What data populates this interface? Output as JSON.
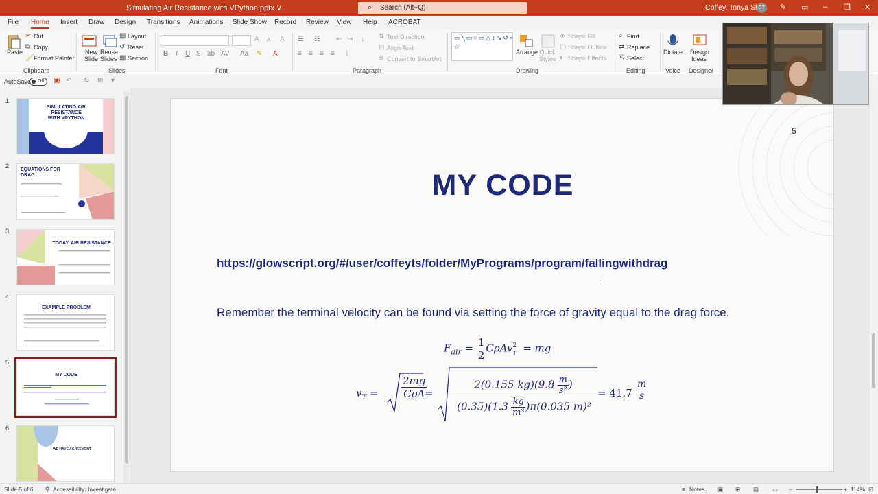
{
  "window": {
    "doc_title": "Simulating Air Resistance with VPython.pptx ∨",
    "search_placeholder": "Search (Alt+Q)",
    "user_name": "Coffey, Tonya Shea",
    "user_initials": "CT"
  },
  "tabs": [
    "File",
    "Home",
    "Insert",
    "Draw",
    "Design",
    "Transitions",
    "Animations",
    "Slide Show",
    "Record",
    "Review",
    "View",
    "Help",
    "ACROBAT"
  ],
  "ribbon": {
    "clipboard": {
      "paste": "Paste",
      "cut": "Cut",
      "copy": "Copy",
      "format_painter": "Format Painter",
      "label": "Clipboard"
    },
    "slides": {
      "new_slide": "New Slide",
      "reuse_slides": "Reuse Slides",
      "layout": "Layout",
      "reset": "Reset",
      "section": "Section",
      "label": "Slides"
    },
    "font": {
      "label": "Font"
    },
    "paragraph": {
      "text_direction": "Text Direction",
      "align_text": "Align Text",
      "convert_smartart": "Convert to SmartArt",
      "label": "Paragraph"
    },
    "drawing": {
      "arrange": "Arrange",
      "quick_styles": "Quick Styles",
      "shape_fill": "Shape Fill",
      "shape_outline": "Shape Outline",
      "shape_effects": "Shape Effects",
      "label": "Drawing"
    },
    "editing": {
      "find": "Find",
      "replace": "Replace",
      "select": "Select",
      "label": "Editing"
    },
    "voice": {
      "dictate": "Dictate",
      "label": "Voice"
    },
    "designer": {
      "design_ideas": "Design Ideas",
      "label": "Designer"
    }
  },
  "qat": {
    "autosave": "AutoSave",
    "toggle": "Off"
  },
  "thumbnails": [
    {
      "num": "1",
      "title": "SIMULATING AIR RESISTANCE WITH VPYTHON"
    },
    {
      "num": "2",
      "title": "EQUATIONS FOR DRAG"
    },
    {
      "num": "3",
      "title": "TODAY, AIR RESISTANCE"
    },
    {
      "num": "4",
      "title": "EXAMPLE PROBLEM"
    },
    {
      "num": "5",
      "title": "MY CODE"
    },
    {
      "num": "6",
      "title": "WE HAVE AGREEMENT"
    }
  ],
  "slide": {
    "page_number": "5",
    "title": "MY CODE",
    "link": "https://glowscript.org/#/user/coffeyts/folder/MyPrograms/program/fallingwithdrag",
    "remember": "Remember the terminal velocity can be found via setting the force of gravity equal to the drag force.",
    "eq1": {
      "lhs": "F",
      "lhs_sub": "air",
      "eq": " = ",
      "half_num": "1",
      "half_den": "2",
      "rest": "CρAv",
      "sub_T": "T",
      "sq": "2",
      "eq2": " = mg"
    },
    "eq2": {
      "lhs": "v",
      "lhs_sub": "T",
      "eq": " = ",
      "r_num": "2mg",
      "r_den": "CρA",
      "eq_b": " = ",
      "big_num": "2(0.155 kg)(9.8",
      "big_num_unit_num": "m",
      "big_num_unit_den": "s²",
      "big_num_close": ")",
      "big_den_a": "(0.35)(1.3",
      "big_den_unit_num": "kg",
      "big_den_unit_den": "m³",
      "big_den_b": ")π(0.035 m)²",
      "result": " = 41.7",
      "res_num": "m",
      "res_den": "s"
    }
  },
  "status": {
    "slide_of": "Slide 5 of 6",
    "accessibility": "Accessibility: Investigate",
    "notes": "Notes",
    "zoom": "114%"
  }
}
